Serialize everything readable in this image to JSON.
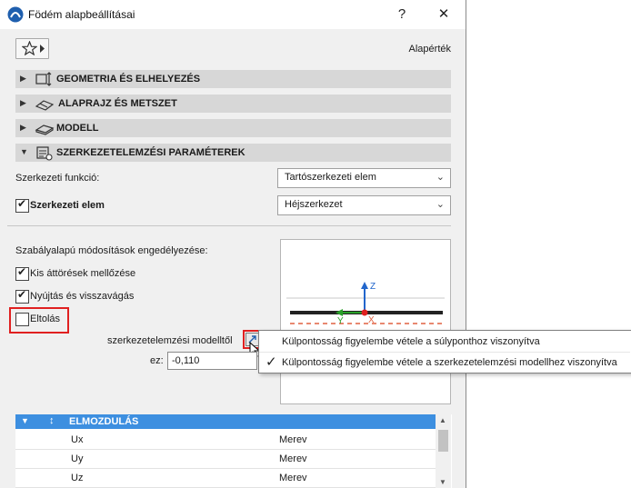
{
  "window": {
    "title": "Födém alapbeállításai",
    "help_label": "?",
    "close_label": "✕"
  },
  "toolbar": {
    "favorites_icon": "star-icon",
    "default_label": "Alapérték"
  },
  "panels": [
    {
      "label": "GEOMETRIA ÉS ELHELYEZÉS",
      "expanded": false
    },
    {
      "label": "ALAPRAJZ ÉS METSZET",
      "expanded": false
    },
    {
      "label": "MODELL",
      "expanded": false
    },
    {
      "label": "SZERKEZETELEMZÉSI PARAMÉTEREK",
      "expanded": true
    }
  ],
  "structural": {
    "function_label": "Szerkezeti funkció:",
    "function_value": "Tartószerkezeti elem",
    "element_label": "Szerkezeti elem",
    "element_checked": true,
    "element_value": "Héjszerkezet"
  },
  "rules": {
    "heading": "Szabályalapú módosítások engedélyezése:",
    "options": [
      {
        "label": "Kis áttörések mellőzése",
        "checked": true
      },
      {
        "label": "Nyújtás és visszavágás",
        "checked": true
      },
      {
        "label": "Eltolás",
        "checked": false
      }
    ]
  },
  "offset": {
    "reference_label": "szerkezetelemzési modelltől",
    "ez_label": "ez:",
    "ez_value": "-0,110"
  },
  "preview": {
    "z_label": "Z",
    "y_label": "Y",
    "x_label": "X"
  },
  "popup": {
    "items": [
      {
        "label": "Külpontosság figyelembe vétele a súlyponthoz viszonyítva",
        "checked": false
      },
      {
        "label": "Külpontosság figyelembe vétele a szerkezetelemzési modellhez viszonyítva",
        "checked": true
      }
    ]
  },
  "table": {
    "header": "ELMOZDULÁS",
    "rows": [
      {
        "name": "Ux",
        "value": "Merev"
      },
      {
        "name": "Uy",
        "value": "Merev"
      },
      {
        "name": "Uz",
        "value": "Merev"
      }
    ]
  },
  "colors": {
    "accent_blue": "#3d8fe0",
    "highlight_red": "#e02020",
    "green_axis": "#2aa02a",
    "blue_axis": "#2266cc"
  }
}
